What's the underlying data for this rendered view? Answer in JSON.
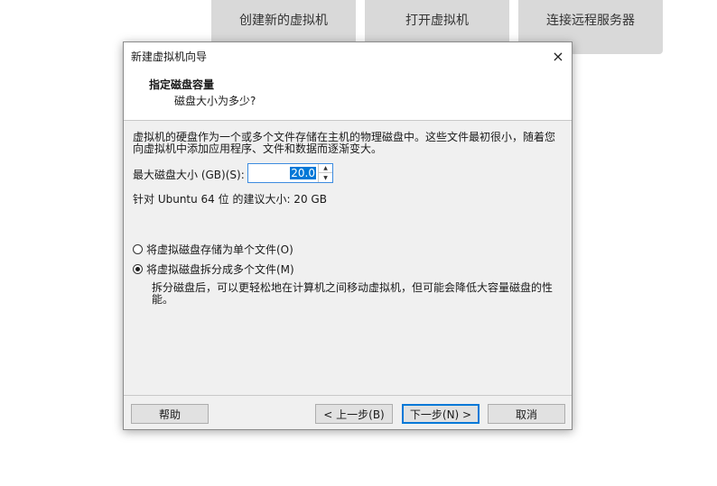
{
  "background": {
    "tiles": [
      {
        "label": "创建新的虚拟机"
      },
      {
        "label": "打开虚拟机"
      },
      {
        "label": "连接远程服务器"
      }
    ]
  },
  "dialog": {
    "title": "新建虚拟机向导",
    "close_icon": "×",
    "header_title": "指定磁盘容量",
    "header_subtitle": "磁盘大小为多少?",
    "description": "虚拟机的硬盘作为一个或多个文件存储在主机的物理磁盘中。这些文件最初很小，随着您向虚拟机中添加应用程序、文件和数据而逐渐变大。",
    "size_label": "最大磁盘大小 (GB)(S):",
    "size_value": "20.0",
    "spin_up": "▲",
    "spin_down": "▼",
    "recommendation": "针对 Ubuntu 64 位 的建议大小: 20 GB",
    "options": [
      {
        "label": "将虚拟磁盘存储为单个文件(O)",
        "checked": false
      },
      {
        "label": "将虚拟磁盘拆分成多个文件(M)",
        "checked": true
      }
    ],
    "split_description": "拆分磁盘后，可以更轻松地在计算机之间移动虚拟机，但可能会降低大容量磁盘的性能。",
    "buttons": {
      "help": "帮助",
      "back": "< 上一步(B)",
      "next": "下一步(N) >",
      "cancel": "取消"
    }
  }
}
